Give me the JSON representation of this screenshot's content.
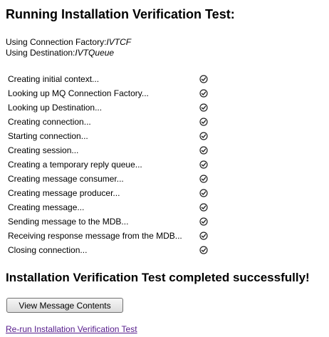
{
  "title": "Running Installation Verification Test:",
  "config": {
    "factory_label": "Using Connection Factory:",
    "factory_value": "IVTCF",
    "destination_label": "Using Destination:",
    "destination_value": "IVTQueue"
  },
  "steps": [
    {
      "label": "Creating initial context...",
      "status": "check-icon"
    },
    {
      "label": "Looking up MQ Connection Factory...",
      "status": "check-icon"
    },
    {
      "label": "Looking up Destination...",
      "status": "check-icon"
    },
    {
      "label": "Creating connection...",
      "status": "check-icon"
    },
    {
      "label": "Starting connection...",
      "status": "check-icon"
    },
    {
      "label": "Creating session...",
      "status": "check-icon"
    },
    {
      "label": "Creating a temporary reply queue...",
      "status": "check-icon"
    },
    {
      "label": "Creating message consumer...",
      "status": "check-icon"
    },
    {
      "label": "Creating message producer...",
      "status": "check-icon"
    },
    {
      "label": "Creating message...",
      "status": "check-icon"
    },
    {
      "label": "Sending message to the MDB...",
      "status": "check-icon"
    },
    {
      "label": "Receiving response message from the MDB...",
      "status": "check-icon"
    },
    {
      "label": "Closing connection...",
      "status": "check-icon"
    }
  ],
  "result": "Installation Verification Test completed successfully!",
  "view_button_label": "View Message Contents",
  "rerun_link_label": "Re-run Installation Verification Test",
  "colors": {
    "link_visited": "#551a8b",
    "text": "#000000"
  }
}
